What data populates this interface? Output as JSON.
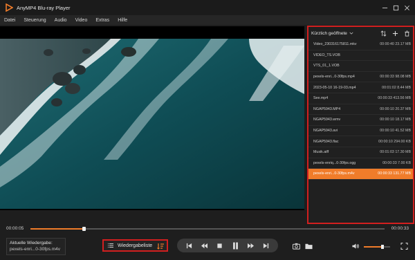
{
  "window": {
    "title": "AnyMP4 Blu-ray Player",
    "logo_icon": "play-triangle-logo",
    "controls": [
      "minimize-icon",
      "maximize-icon",
      "close-icon"
    ]
  },
  "menu": {
    "items": [
      "Datei",
      "Steuerung",
      "Audio",
      "Video",
      "Extras",
      "Hilfe"
    ]
  },
  "playlist": {
    "title": "Kürzlich geöffnete",
    "border_color": "#d21f1f",
    "items": [
      {
        "name": "Video_230316175811.mkv",
        "meta": "00:00:40 23.17 MB",
        "active": false
      },
      {
        "name": "VIDEO_TS.VOB",
        "meta": "",
        "active": false
      },
      {
        "name": "VTS_01_1.VOB",
        "meta": "",
        "active": false
      },
      {
        "name": "pexels-enri...0-30fps.mp4",
        "meta": "00:00:33 98.08 MB",
        "active": false
      },
      {
        "name": "2023-05-10 16-19-03.mp4",
        "meta": "00:01:02 8.44 MB",
        "active": false
      },
      {
        "name": "See.mp4",
        "meta": "00:00:33 413.56 MB",
        "active": false
      },
      {
        "name": "NGAP5943.MP4",
        "meta": "00:00:10 20.37 MB",
        "active": false
      },
      {
        "name": "NGAP5943.wmv",
        "meta": "00:00:10 18.17 MB",
        "active": false
      },
      {
        "name": "NGAP5943.avi",
        "meta": "00:00:10 41.52 MB",
        "active": false
      },
      {
        "name": "NGAP5943.flac",
        "meta": "00:00:10 294.00 KB",
        "active": false
      },
      {
        "name": "Musik.aiff",
        "meta": "00:01:03 17.30 MB",
        "active": false
      },
      {
        "name": "pexels-enriq...0-30fps.ogg",
        "meta": "00:00:33 7.00 KB",
        "active": false
      },
      {
        "name": "pexels-enri...0-30fps.m4v",
        "meta": "00:00:33 131.77 MB",
        "active": true
      }
    ]
  },
  "seek": {
    "current": "00:00:05",
    "total": "00:00:33",
    "progress": 0.15
  },
  "now_playing": {
    "label": "Aktuelle Wiedergabe:",
    "file": "pexels-enri...0-30fps.m4v"
  },
  "playlist_button": {
    "label": "Wiedergabeliste"
  },
  "volume": {
    "level": 0.7
  },
  "colors": {
    "accent": "#f07c2a",
    "highlight_border": "#d21f1f",
    "background": "#1e1e1e"
  }
}
